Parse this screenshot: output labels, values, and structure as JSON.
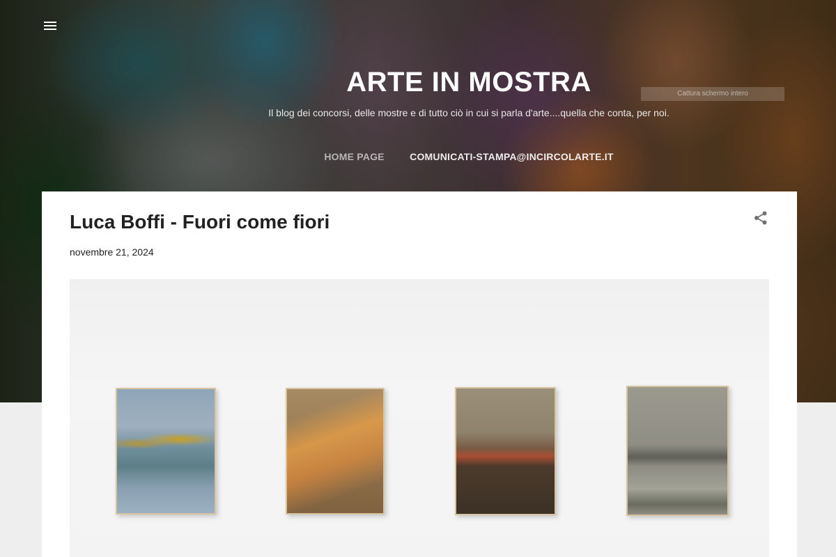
{
  "header": {
    "menu_icon": "hamburger-menu-icon",
    "title": "ARTE IN MOSTRA",
    "description": "Il blog dei concorsi, delle mostre e di tutto ciò in cui si parla d'arte....quella che conta, per noi.",
    "screenshot_label": "Cattura schermo intero"
  },
  "nav": {
    "items": [
      {
        "label": "HOME PAGE"
      },
      {
        "label": "COMUNICATI-STAMPA@INCIRCOLARTE.IT"
      }
    ]
  },
  "post": {
    "title": "Luca Boffi - Fuori come fiori",
    "date": "novembre 21, 2024",
    "share_icon": "share-icon",
    "image_description_icon": "exhibition-photo"
  },
  "colors": {
    "card_background": "#ffffff",
    "page_background": "#eeeeee",
    "title_text": "#212121",
    "header_text": "#ffffff"
  }
}
